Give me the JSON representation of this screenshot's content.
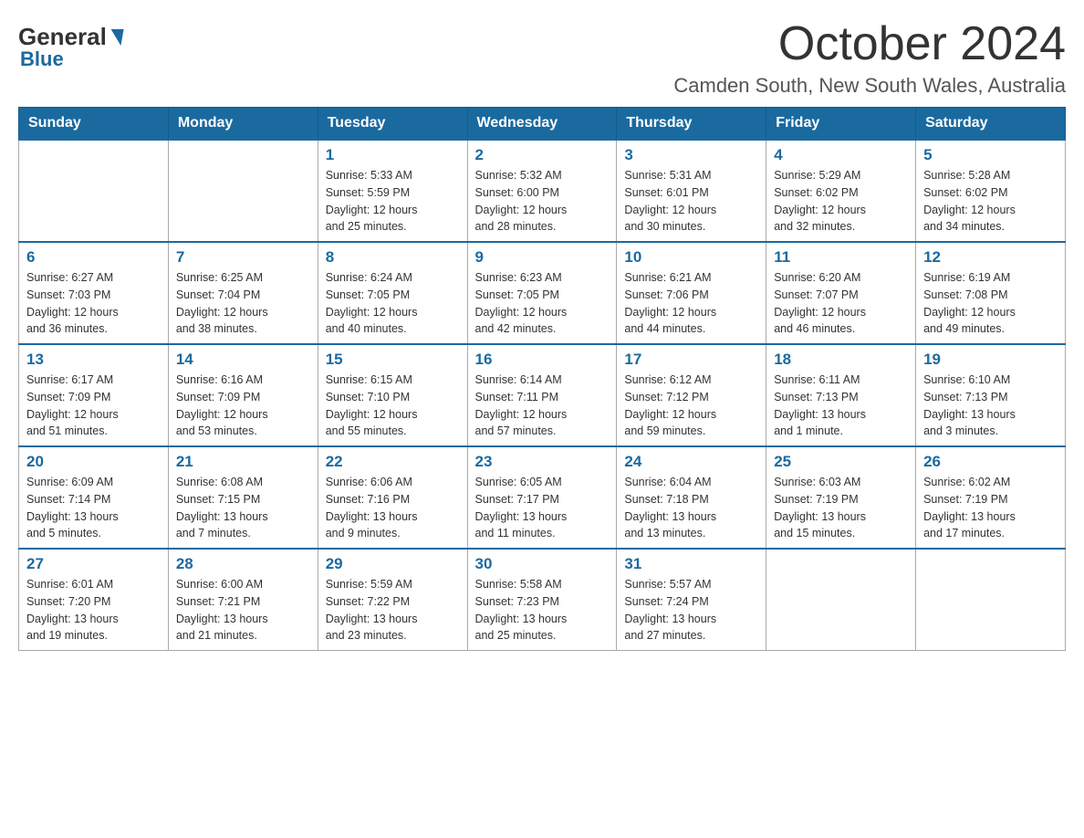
{
  "header": {
    "logo": {
      "general": "General",
      "blue": "Blue"
    },
    "title": "October 2024",
    "location": "Camden South, New South Wales, Australia"
  },
  "days_of_week": [
    "Sunday",
    "Monday",
    "Tuesday",
    "Wednesday",
    "Thursday",
    "Friday",
    "Saturday"
  ],
  "weeks": [
    [
      {
        "day": "",
        "info": ""
      },
      {
        "day": "",
        "info": ""
      },
      {
        "day": "1",
        "info": "Sunrise: 5:33 AM\nSunset: 5:59 PM\nDaylight: 12 hours\nand 25 minutes."
      },
      {
        "day": "2",
        "info": "Sunrise: 5:32 AM\nSunset: 6:00 PM\nDaylight: 12 hours\nand 28 minutes."
      },
      {
        "day": "3",
        "info": "Sunrise: 5:31 AM\nSunset: 6:01 PM\nDaylight: 12 hours\nand 30 minutes."
      },
      {
        "day": "4",
        "info": "Sunrise: 5:29 AM\nSunset: 6:02 PM\nDaylight: 12 hours\nand 32 minutes."
      },
      {
        "day": "5",
        "info": "Sunrise: 5:28 AM\nSunset: 6:02 PM\nDaylight: 12 hours\nand 34 minutes."
      }
    ],
    [
      {
        "day": "6",
        "info": "Sunrise: 6:27 AM\nSunset: 7:03 PM\nDaylight: 12 hours\nand 36 minutes."
      },
      {
        "day": "7",
        "info": "Sunrise: 6:25 AM\nSunset: 7:04 PM\nDaylight: 12 hours\nand 38 minutes."
      },
      {
        "day": "8",
        "info": "Sunrise: 6:24 AM\nSunset: 7:05 PM\nDaylight: 12 hours\nand 40 minutes."
      },
      {
        "day": "9",
        "info": "Sunrise: 6:23 AM\nSunset: 7:05 PM\nDaylight: 12 hours\nand 42 minutes."
      },
      {
        "day": "10",
        "info": "Sunrise: 6:21 AM\nSunset: 7:06 PM\nDaylight: 12 hours\nand 44 minutes."
      },
      {
        "day": "11",
        "info": "Sunrise: 6:20 AM\nSunset: 7:07 PM\nDaylight: 12 hours\nand 46 minutes."
      },
      {
        "day": "12",
        "info": "Sunrise: 6:19 AM\nSunset: 7:08 PM\nDaylight: 12 hours\nand 49 minutes."
      }
    ],
    [
      {
        "day": "13",
        "info": "Sunrise: 6:17 AM\nSunset: 7:09 PM\nDaylight: 12 hours\nand 51 minutes."
      },
      {
        "day": "14",
        "info": "Sunrise: 6:16 AM\nSunset: 7:09 PM\nDaylight: 12 hours\nand 53 minutes."
      },
      {
        "day": "15",
        "info": "Sunrise: 6:15 AM\nSunset: 7:10 PM\nDaylight: 12 hours\nand 55 minutes."
      },
      {
        "day": "16",
        "info": "Sunrise: 6:14 AM\nSunset: 7:11 PM\nDaylight: 12 hours\nand 57 minutes."
      },
      {
        "day": "17",
        "info": "Sunrise: 6:12 AM\nSunset: 7:12 PM\nDaylight: 12 hours\nand 59 minutes."
      },
      {
        "day": "18",
        "info": "Sunrise: 6:11 AM\nSunset: 7:13 PM\nDaylight: 13 hours\nand 1 minute."
      },
      {
        "day": "19",
        "info": "Sunrise: 6:10 AM\nSunset: 7:13 PM\nDaylight: 13 hours\nand 3 minutes."
      }
    ],
    [
      {
        "day": "20",
        "info": "Sunrise: 6:09 AM\nSunset: 7:14 PM\nDaylight: 13 hours\nand 5 minutes."
      },
      {
        "day": "21",
        "info": "Sunrise: 6:08 AM\nSunset: 7:15 PM\nDaylight: 13 hours\nand 7 minutes."
      },
      {
        "day": "22",
        "info": "Sunrise: 6:06 AM\nSunset: 7:16 PM\nDaylight: 13 hours\nand 9 minutes."
      },
      {
        "day": "23",
        "info": "Sunrise: 6:05 AM\nSunset: 7:17 PM\nDaylight: 13 hours\nand 11 minutes."
      },
      {
        "day": "24",
        "info": "Sunrise: 6:04 AM\nSunset: 7:18 PM\nDaylight: 13 hours\nand 13 minutes."
      },
      {
        "day": "25",
        "info": "Sunrise: 6:03 AM\nSunset: 7:19 PM\nDaylight: 13 hours\nand 15 minutes."
      },
      {
        "day": "26",
        "info": "Sunrise: 6:02 AM\nSunset: 7:19 PM\nDaylight: 13 hours\nand 17 minutes."
      }
    ],
    [
      {
        "day": "27",
        "info": "Sunrise: 6:01 AM\nSunset: 7:20 PM\nDaylight: 13 hours\nand 19 minutes."
      },
      {
        "day": "28",
        "info": "Sunrise: 6:00 AM\nSunset: 7:21 PM\nDaylight: 13 hours\nand 21 minutes."
      },
      {
        "day": "29",
        "info": "Sunrise: 5:59 AM\nSunset: 7:22 PM\nDaylight: 13 hours\nand 23 minutes."
      },
      {
        "day": "30",
        "info": "Sunrise: 5:58 AM\nSunset: 7:23 PM\nDaylight: 13 hours\nand 25 minutes."
      },
      {
        "day": "31",
        "info": "Sunrise: 5:57 AM\nSunset: 7:24 PM\nDaylight: 13 hours\nand 27 minutes."
      },
      {
        "day": "",
        "info": ""
      },
      {
        "day": "",
        "info": ""
      }
    ]
  ]
}
